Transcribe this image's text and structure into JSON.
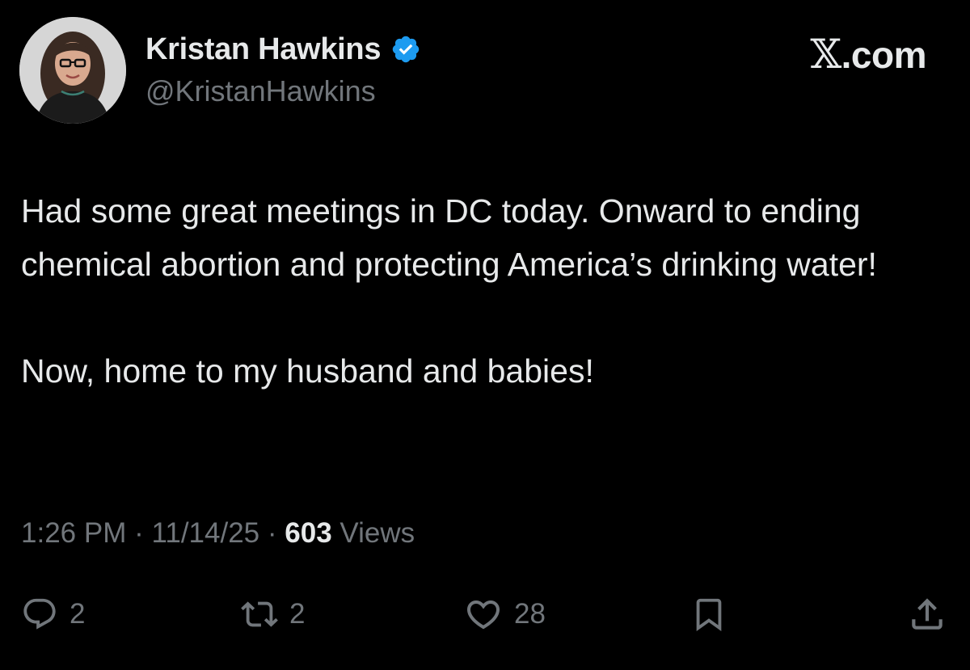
{
  "author": {
    "display_name": "Kristan Hawkins",
    "handle": "@KristanHawkins",
    "verified": true,
    "avatar_icon": "profile-photo"
  },
  "brand": {
    "x_mark": "𝕏",
    "label": ".com"
  },
  "tweet": {
    "paragraphs": [
      "Had some great meetings in DC today. Onward to ending chemical abortion and protecting America’s drinking water!",
      "Now, home to my husband and babies!"
    ],
    "time": "1:26 PM",
    "date": "11/14/25",
    "separator": "·",
    "views_count": "603",
    "views_label": "Views"
  },
  "actions": {
    "reply": {
      "icon": "reply-icon",
      "count": "2"
    },
    "retweet": {
      "icon": "retweet-icon",
      "count": "2"
    },
    "like": {
      "icon": "heart-icon",
      "count": "28"
    },
    "bookmark": {
      "icon": "bookmark-icon"
    },
    "share": {
      "icon": "share-icon"
    }
  },
  "colors": {
    "background": "#000000",
    "text_primary": "#e7e9ea",
    "text_secondary": "#71767b",
    "verified_badge": "#1d9bf0"
  }
}
